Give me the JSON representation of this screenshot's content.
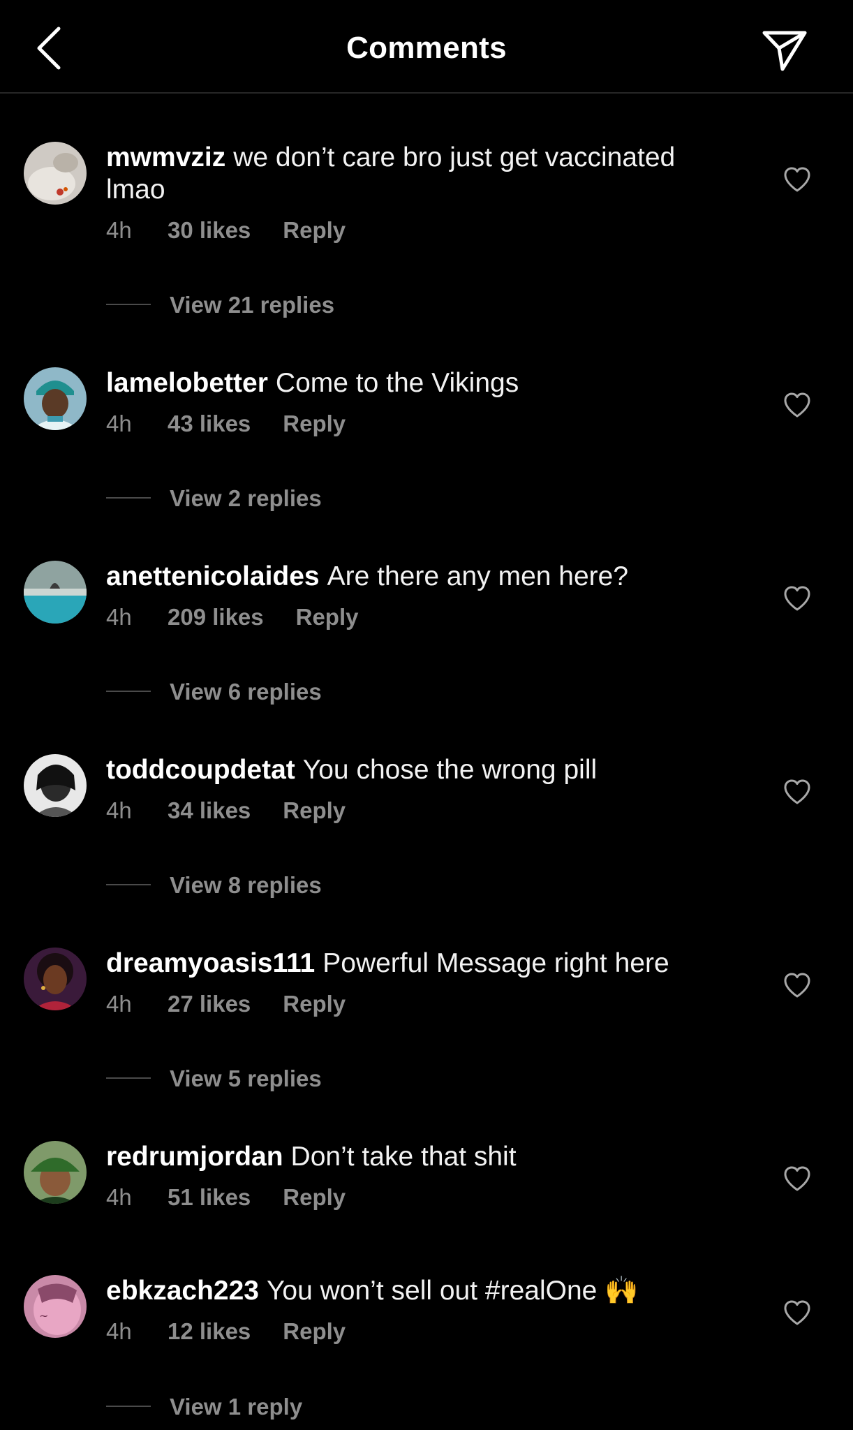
{
  "header": {
    "title": "Comments",
    "back_icon": "chevron-left-icon",
    "send_icon": "paper-plane-icon"
  },
  "colors": {
    "background": "#000000",
    "text_primary": "#ffffff",
    "text_secondary": "#8e8e8e",
    "divider": "#262626"
  },
  "comments": [
    {
      "username": "mwmvziz",
      "text": "we don’t care bro just get vaccinated lmao",
      "time": "4h",
      "likes": "30 likes",
      "reply_label": "Reply",
      "view_replies": "View 21 replies"
    },
    {
      "username": "lamelobetter",
      "text": "Come to the Vikings",
      "time": "4h",
      "likes": "43 likes",
      "reply_label": "Reply",
      "view_replies": "View 2 replies"
    },
    {
      "username": "anettenicolaides",
      "text": "Are there any men here?",
      "time": "4h",
      "likes": "209 likes",
      "reply_label": "Reply",
      "view_replies": "View 6 replies"
    },
    {
      "username": "toddcoupdetat",
      "text": "You chose the wrong pill",
      "time": "4h",
      "likes": "34 likes",
      "reply_label": "Reply",
      "view_replies": "View 8 replies"
    },
    {
      "username": "dreamyoasis111",
      "text": "Powerful Message right here",
      "time": "4h",
      "likes": "27 likes",
      "reply_label": "Reply",
      "view_replies": "View 5 replies"
    },
    {
      "username": "redrumjordan",
      "text": "Don’t take that shit",
      "time": "4h",
      "likes": "51 likes",
      "reply_label": "Reply"
    },
    {
      "username": "ebkzach223",
      "text": "You won’t sell out #realOne 🙌",
      "time": "4h",
      "likes": "12 likes",
      "reply_label": "Reply",
      "view_replies": "View 1 reply"
    }
  ]
}
